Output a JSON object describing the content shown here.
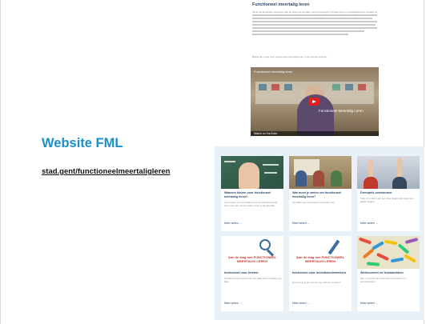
{
  "article": {
    "heading": "Functioneel meertalig leren",
    "para1": "Wil je als leerkracht stad.gent aan de slag met de talen van je leerlingen? Ontdek hoe je meertaligheid kan inzetten als",
    "para2": "Bekijk hier meer over functioneel meertalig leren in de Gentse scholen."
  },
  "video": {
    "title": "Functioneel meertalig leren",
    "caption": "Functioneel Meertalig Leren",
    "bar_text": "Watch on YouTube"
  },
  "slide": {
    "title": "Website FML",
    "url": "stad.gent/functioneelmeertaligleren"
  },
  "cards": [
    {
      "title": "Waarom kiezen voor functioneel meertalig leren?",
      "desc": "Lees meer over het belang van de thuistaal bij het leren van een nieuwe taal en hoe je dit aanpakt.",
      "more": "Meer weten  →"
    },
    {
      "title": "Wat moet je weten om functioneel meertalig leren?",
      "desc": "Het ABC van functioneel meertalig leren.",
      "more": "Meer weten  →"
    },
    {
      "title": "Drempels overwinnen",
      "desc": "Stap voor stap naar een klas waarin alle talen een plaats krijgen.",
      "more": "Meer weten  →"
    },
    {
      "title": "Instrument voor leraren",
      "desc": "Ontdek hoe je functioneel meertalig leren toepast in je klas.",
      "more": "Meer weten  →",
      "logo": "Aan de slag met FUNCTIONEEL MEERTALIG LEREN"
    },
    {
      "title": "Instrument voor beleidsmedewerkers",
      "desc": "Hoe breng je het thema in je school en team?",
      "more": "Meer weten  →",
      "logo": "Aan de slag met FUNCTIONEEL MEERTALIG LEREN"
    },
    {
      "title": "Werkvormen en lesmaterialen",
      "desc": "Een overzicht van concrete werkvormen en lesmaterialen.",
      "more": "Meer weten  →"
    }
  ],
  "colors": {
    "title": "#1b8fc9",
    "panel": "#e8f1f8",
    "card_title": "#2b4a6b"
  },
  "icons": [
    "play-icon",
    "magnifier-icon",
    "pencil-icon"
  ]
}
